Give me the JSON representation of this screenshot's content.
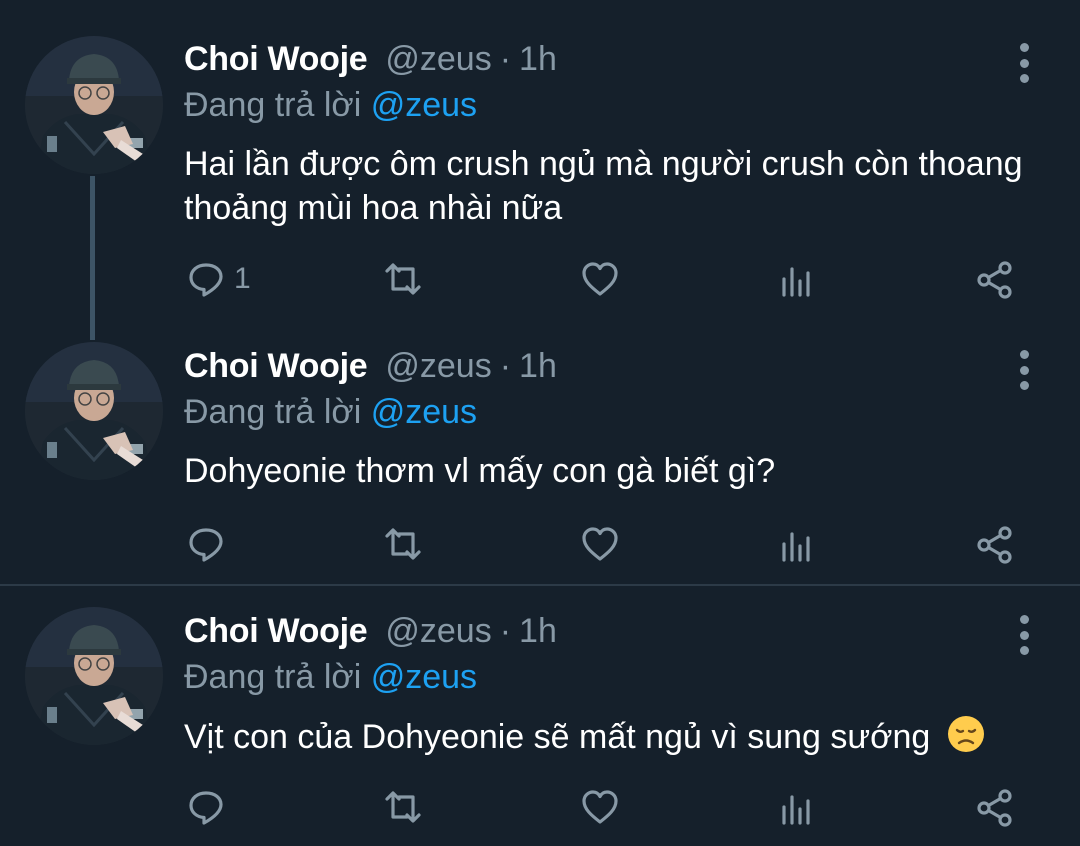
{
  "tweets": [
    {
      "name": "Choi Wooje",
      "handle": "@zeus",
      "dot": "·",
      "time": "1h",
      "reply_prefix": "Đang trả lời ",
      "reply_to": "@zeus",
      "text": "Hai lần được ôm crush ngủ mà người crush còn thoang thoảng mùi hoa nhài nữa",
      "reply_count": "1"
    },
    {
      "name": "Choi Wooje",
      "handle": "@zeus",
      "dot": "·",
      "time": "1h",
      "reply_prefix": "Đang trả lời ",
      "reply_to": "@zeus",
      "text": "Dohyeonie thơm vl mấy con gà biết gì?",
      "reply_count": ""
    },
    {
      "name": "Choi Wooje",
      "handle": "@zeus",
      "dot": "·",
      "time": "1h",
      "reply_prefix": "Đang trả lời ",
      "reply_to": "@zeus",
      "text": "Vịt con của Dohyeonie sẽ mất ngủ vì sung sướng",
      "emoji": "disappointed-face-emoji",
      "reply_count": ""
    }
  ],
  "icons": {
    "reply": "reply-icon",
    "retweet": "retweet-icon",
    "like": "like-icon",
    "analytics": "analytics-icon",
    "share": "share-icon",
    "more": "more-vertical-icon"
  },
  "colors": {
    "background": "#15202b",
    "secondary_text": "#8899a6",
    "mention": "#1da1f2",
    "thread_line": "#3d5466",
    "divider": "#2c3a47"
  }
}
